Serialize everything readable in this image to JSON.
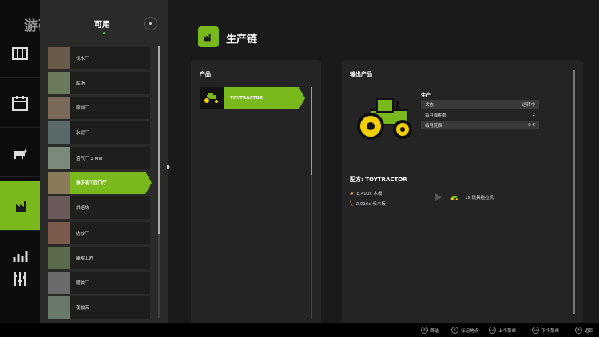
{
  "watermark": "游研社",
  "list": {
    "header": "可用",
    "items": [
      {
        "label": "伐木厂",
        "thumb": "#6a5a4a"
      },
      {
        "label": "库场",
        "thumb": "#6a7a5a"
      },
      {
        "label": "榨油厂",
        "thumb": "#7a6a5a"
      },
      {
        "label": "水泥厂",
        "thumb": "#5a6a6a"
      },
      {
        "label": "沼气厂 1 MW",
        "thumb": "#7a8a7a"
      },
      {
        "label": "游乐场工匠门厅",
        "thumb": "#8a7a5a"
      },
      {
        "label": "烘焙坊",
        "thumb": "#6a5a5a"
      },
      {
        "label": "纺纱厂",
        "thumb": "#7a5a4a"
      },
      {
        "label": "绳索工匠",
        "thumb": "#5a6a4a"
      },
      {
        "label": "罐装厂",
        "thumb": "#6a6a6a"
      },
      {
        "label": "夜咖店",
        "thumb": "#6a7a6a"
      }
    ],
    "active_index": 5
  },
  "page_title": "生产链",
  "products_panel": {
    "title": "产品",
    "items": [
      {
        "label": "TOYTRACTOR"
      }
    ]
  },
  "output_panel": {
    "title": "输出产品",
    "production_heading": "生产",
    "rows": [
      {
        "label": "状态",
        "value": "运转中"
      },
      {
        "label": "每月周期数",
        "value": "2"
      },
      {
        "label": "每月花费",
        "value": "0 €"
      }
    ],
    "recipe_title": "配方: TOYTRACTOR",
    "ingredients": [
      {
        "icon": "wood-plank-icon",
        "text": "8,400x 木板"
      },
      {
        "icon": "long-plank-icon",
        "text": "2,016x 长木板"
      }
    ],
    "output": "1x 玩具拖拉机"
  },
  "hints": [
    {
      "key": "Ⓑ",
      "label": "筛选"
    },
    {
      "key": "Ⓨ",
      "label": "标记地点"
    },
    {
      "key": "LB",
      "label": "上个菜单"
    },
    {
      "key": "RB",
      "label": "下个菜单"
    },
    {
      "key": "Ⓑ",
      "label": "返回"
    }
  ],
  "colors": {
    "accent": "#79b91c",
    "panel": "#242424"
  }
}
